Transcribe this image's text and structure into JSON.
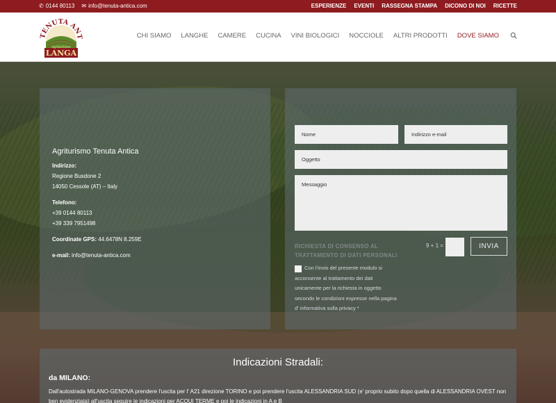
{
  "topbar": {
    "phone": "0144 80113",
    "email": "info@tenuta-antica.com",
    "links": [
      "ESPERIENZE",
      "EVENTI",
      "RASSEGNA STAMPA",
      "DICONO DI NOI",
      "RICETTE"
    ]
  },
  "logo": {
    "line1": "TENUTA ANTICA",
    "line2": "LANGA",
    "line3": "Agriturismo"
  },
  "nav": {
    "items": [
      "CHI SIAMO",
      "LANGHE",
      "CAMERE",
      "CUCINA",
      "VINI BIOLOGICI",
      "NOCCIOLE",
      "ALTRI PRODOTTI",
      "DOVE SIAMO"
    ],
    "active": "DOVE SIAMO"
  },
  "info": {
    "title": "Agriturismo Tenuta Antica",
    "address_label": "Indirizzo:",
    "address_line1": "Regione Busdone 2",
    "address_line2": "14050 Cessole (AT) – Italy",
    "phone_label": "Telefono:",
    "phone1": "+39 0144 80113",
    "phone2": "+39 339 7951498",
    "gps_label": "Coordinate GPS:",
    "gps_value": "44.6478N 8.259E",
    "email_label": "e-mail:",
    "email_value": "info@tenuta-antica.com"
  },
  "form": {
    "name_placeholder": "Nome",
    "email_placeholder": "Indirizzo e-mail",
    "subject_placeholder": "Oggetto",
    "message_placeholder": "Messaggio",
    "consent_title_1": "RICHIESTA DI CONSENSO AL",
    "consent_title_2": "TRATTAMENTO DI DATI PERSONALI",
    "captcha_question": "9 + 1 =",
    "send_label": "INVIA",
    "consent_text": "Con l'invio del presente modulo si acconsente al trattamento dei dati unicamente per la richiesta in oggetto secondo le condizioni espresse nella pagina d' informativa sulla privacy *"
  },
  "directions": {
    "title": "Indicazioni Stradali:",
    "from_label": "da MILANO:",
    "text": "Dall'autostrada MILANO-GENOVA prendere l'uscita per l' A21 direzione TORINO e poi prendere l'uscita ALESSANDRIA SUD (e' proprio subito dopo quella di ALESSANDRIA OVEST non ben evidenziata) all'uscita seguire le indicazioni per ACQUI TERME e poi le indicazioni in A e B"
  },
  "colors": {
    "brand": "#8e1b1f",
    "white": "#ffffff"
  }
}
